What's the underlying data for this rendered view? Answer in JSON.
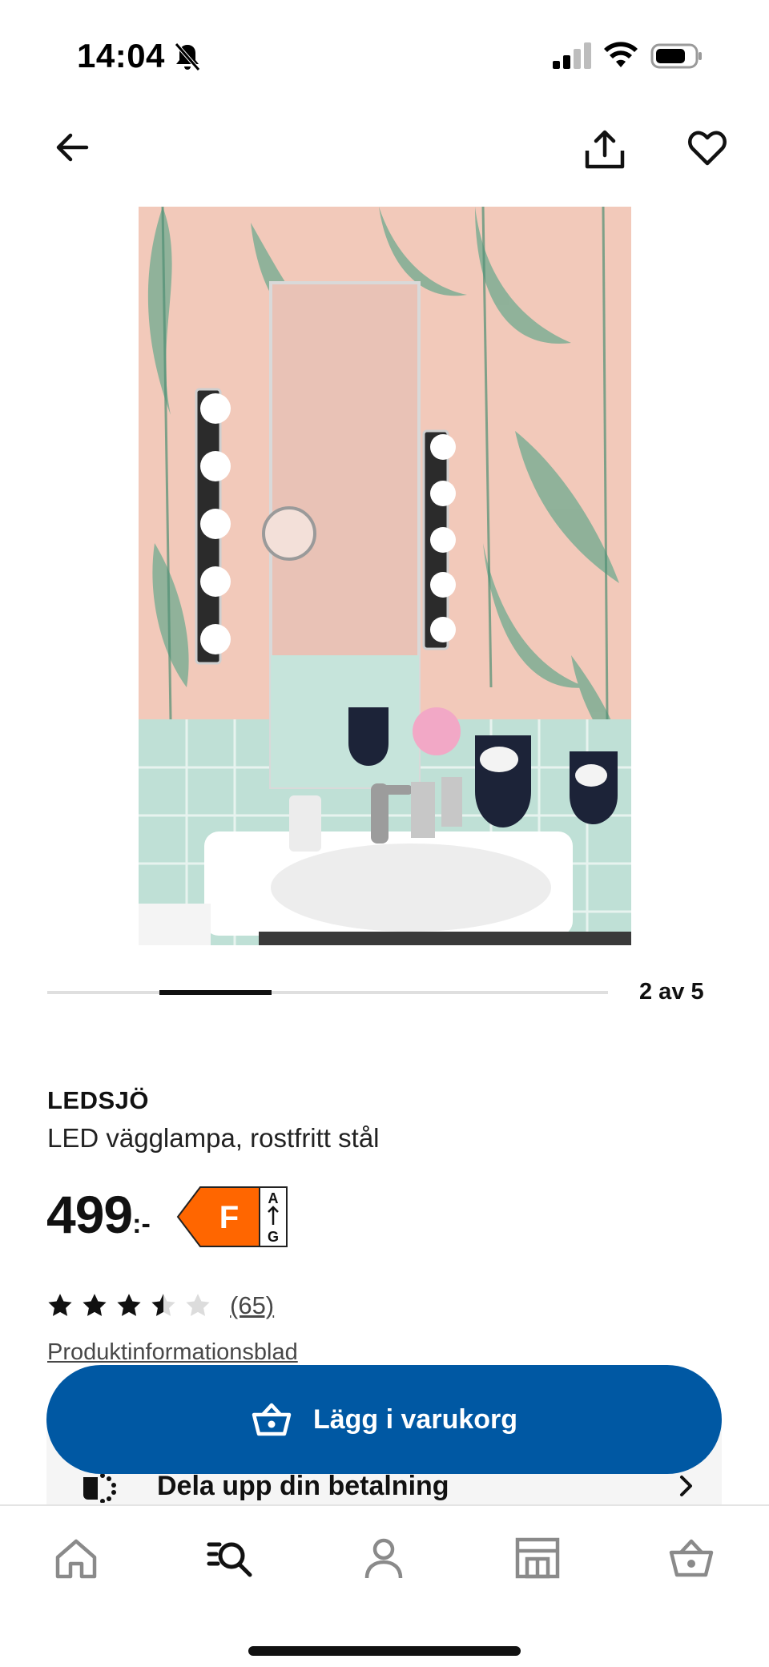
{
  "status_bar": {
    "time": "14:04",
    "icons": [
      "bell-muted-icon",
      "cellular-signal-icon",
      "wifi-icon",
      "battery-icon"
    ]
  },
  "nav": {
    "icons": [
      "arrow-left-icon",
      "share-icon",
      "heart-icon"
    ]
  },
  "carousel": {
    "count_label": "2 av 5",
    "current": 2,
    "total": 5
  },
  "product": {
    "name": "LEDSJÖ",
    "description": "LED vägglampa, rostfritt stål",
    "price_main": "499",
    "price_suffix": ":-",
    "energy_class": "F",
    "energy_scale_top": "A",
    "energy_scale_bottom": "G",
    "energy_color": "#ff6600",
    "rating": 3.5,
    "rating_max": 5,
    "review_count": "(65)",
    "info_link": "Produktinformationsblad"
  },
  "actions": {
    "add_to_cart": "Lägg i varukorg",
    "split_payment": "Dela upp din betalning"
  },
  "tab_bar": {
    "items": [
      "home-icon",
      "search-icon",
      "profile-icon",
      "store-icon",
      "cart-icon"
    ],
    "active": "search-icon"
  },
  "colors": {
    "primary": "#0058a3",
    "text": "#111111",
    "muted": "#484848"
  }
}
